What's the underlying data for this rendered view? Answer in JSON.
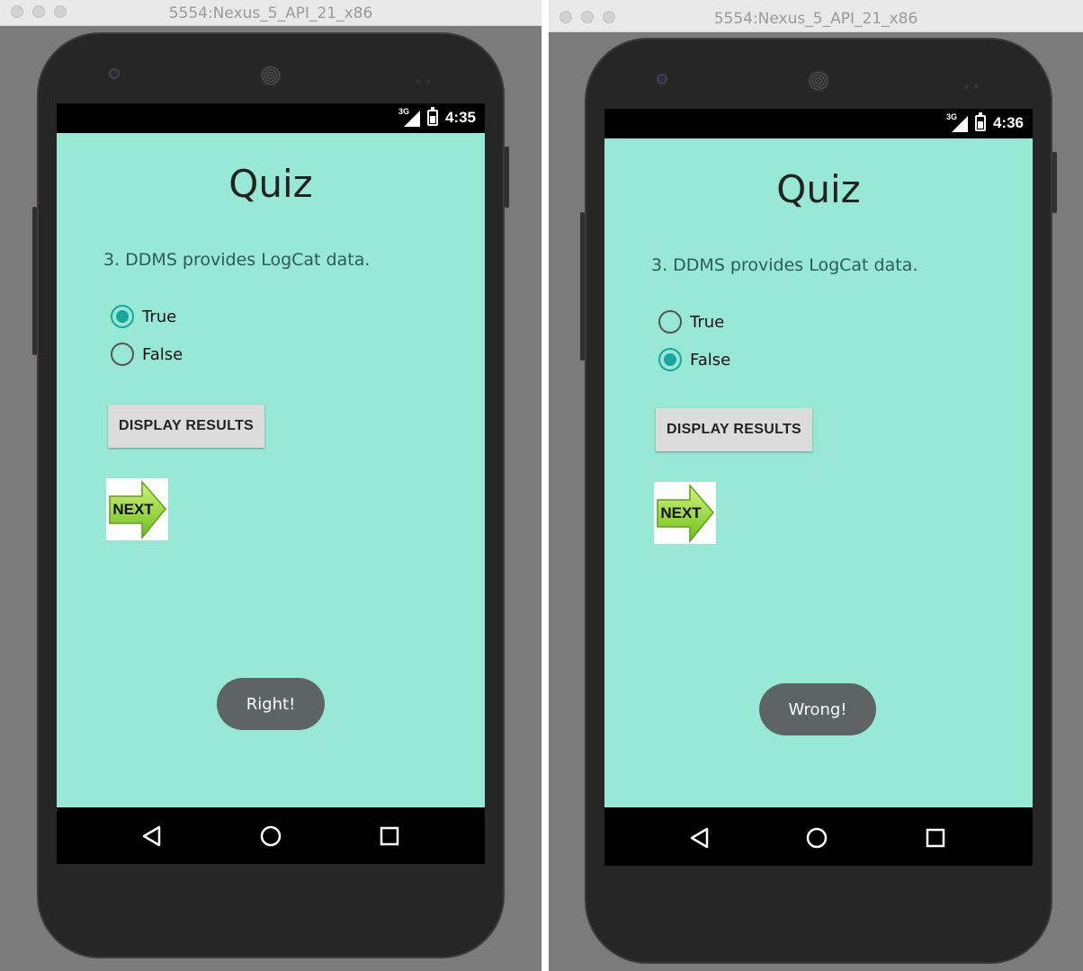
{
  "app_bg_color": "#98e8d6",
  "accent_color": "#1ba59a",
  "left": {
    "window_title": "5554:Nexus_5_API_21_x86",
    "status": {
      "network": "3G",
      "time": "4:35"
    },
    "quiz_title": "Quiz",
    "question": "3. DDMS provides LogCat data.",
    "options": [
      {
        "label": "True",
        "checked": true
      },
      {
        "label": "False",
        "checked": false
      }
    ],
    "display_results_label": "DISPLAY RESULTS",
    "next_label": "NEXT",
    "toast": "Right!",
    "nav": [
      "back-icon",
      "home-icon",
      "recents-icon"
    ]
  },
  "right": {
    "window_title": "5554:Nexus_5_API_21_x86",
    "status": {
      "network": "3G",
      "time": "4:36"
    },
    "quiz_title": "Quiz",
    "question": "3. DDMS provides LogCat data.",
    "options": [
      {
        "label": "True",
        "checked": false
      },
      {
        "label": "False",
        "checked": true
      }
    ],
    "display_results_label": "DISPLAY RESULTS",
    "next_label": "NEXT",
    "toast": "Wrong!",
    "nav": [
      "back-icon",
      "home-icon",
      "recents-icon"
    ]
  }
}
